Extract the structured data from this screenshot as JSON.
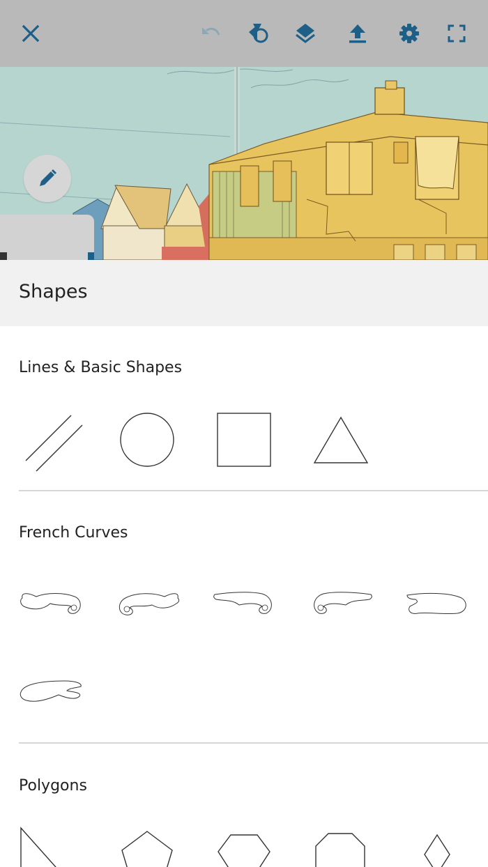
{
  "toolbar": {
    "icons": [
      "close-icon",
      "undo-icon",
      "redo-shapes-icon",
      "layers-icon",
      "upload-icon",
      "settings-icon",
      "fullscreen-icon"
    ],
    "accent_color": "#1d5f86",
    "disabled_color": "#8fa6b4"
  },
  "panel": {
    "title": "Shapes"
  },
  "sections": {
    "lines_basic": {
      "label": "Lines & Basic Shapes",
      "shapes": [
        "parallel-lines",
        "circle",
        "square",
        "triangle"
      ]
    },
    "french_curves": {
      "label": "French Curves",
      "count": 6
    },
    "polygons": {
      "label": "Polygons",
      "shapes": [
        "right-triangle",
        "pentagon",
        "hexagon",
        "octagon",
        "diamond"
      ]
    }
  }
}
